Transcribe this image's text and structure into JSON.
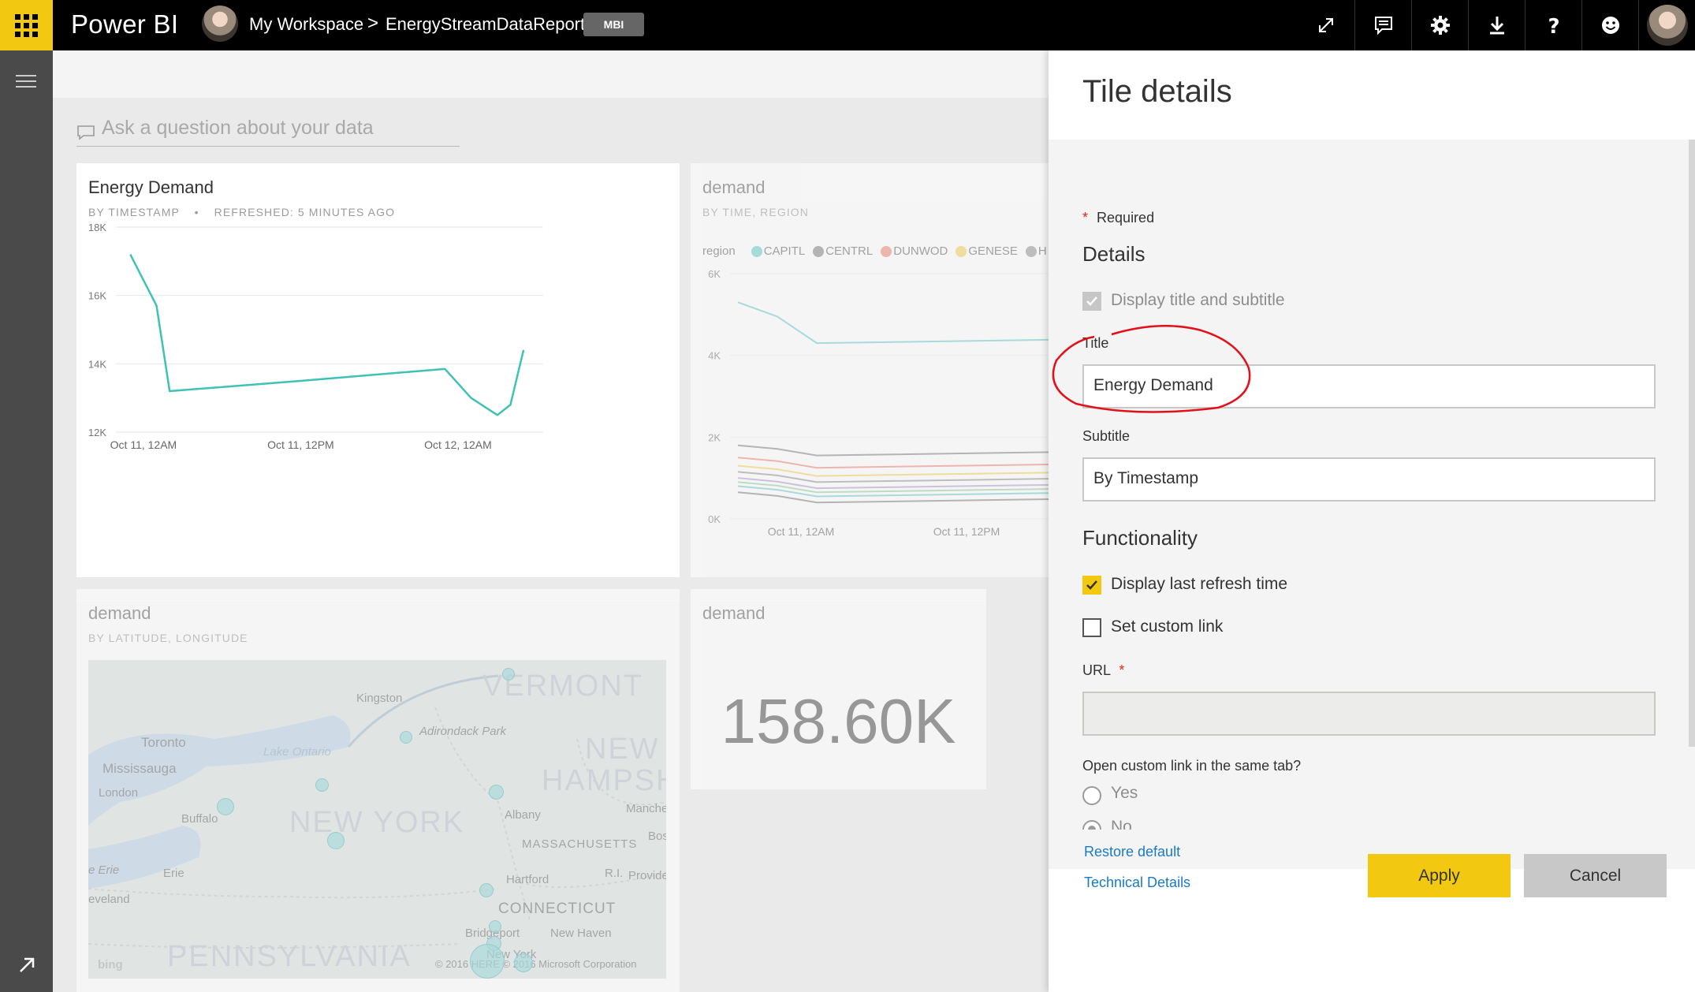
{
  "topbar": {
    "brand": "Power BI",
    "breadcrumb_workspace": "My Workspace",
    "breadcrumb_separator": ">",
    "breadcrumb_report": "EnergyStreamDataReport",
    "badge": "MBI",
    "accent_color": "#f2c811",
    "icons": [
      "expand-icon",
      "comment-icon",
      "gear-icon",
      "download-icon",
      "help-icon",
      "smiley-icon",
      "user-avatar"
    ]
  },
  "qna": {
    "placeholder": "Ask a question about your data"
  },
  "tiles": {
    "energy_demand": {
      "title": "Energy Demand",
      "subtitle": "BY TIMESTAMP",
      "separator": "•",
      "refreshed": "REFRESHED: 5 MINUTES AGO"
    },
    "demand_region": {
      "title": "demand",
      "subtitle": "BY TIME, REGION",
      "legend_label": "region",
      "legend": [
        {
          "name": "CAPITL",
          "color": "#72cdce"
        },
        {
          "name": "CENTRL",
          "color": "#888888"
        },
        {
          "name": "DUNWOD",
          "color": "#f08a7e"
        },
        {
          "name": "GENESE",
          "color": "#f2d45c"
        },
        {
          "name": "H",
          "color": "#999999"
        }
      ]
    },
    "demand_map": {
      "title": "demand",
      "subtitle": "BY LATITUDE, LONGITUDE",
      "labels": {
        "toronto": "Toronto",
        "mississauga": "Mississauga",
        "london": "London",
        "buffalo": "Buffalo",
        "kingston": "Kingston",
        "lake_ontario": "Lake Ontario",
        "adirondack": "Adirondack Park",
        "albany": "Albany",
        "erie_lake": "e Erie",
        "erie": "Erie",
        "cleveland": "eveland",
        "hartford": "Hartford",
        "providence": "Provide",
        "new_haven": "New Haven",
        "bridgeport": "Bridgeport",
        "manchester": "Manche",
        "boston": "Bos",
        "new_york_city": "New York",
        "ri": "R.I.",
        "vermont": "VERMONT",
        "new_hampshire_1": "NEW",
        "new_hampshire_2": "HAMPSHI",
        "new_york": "NEW YORK",
        "massachusetts": "MASSACHUSETTS",
        "connecticut": "CONNECTICUT",
        "pennsylvania": "PENNSYLVANIA",
        "bing": "bing",
        "copyright": "© 2016 HERE  © 2016 Microsoft Corporation"
      }
    },
    "demand_kpi": {
      "title": "demand",
      "value": "158.60K"
    }
  },
  "chart_data": [
    {
      "type": "line",
      "title": "Energy Demand",
      "subtitle": "BY TIMESTAMP",
      "x_ticks": [
        "Oct 11, 12AM",
        "Oct 11, 12PM",
        "Oct 12, 12AM"
      ],
      "y_ticks": [
        "12K",
        "14K",
        "16K",
        "18K"
      ],
      "ylim": [
        12000,
        18000
      ],
      "color": "#3fc1b7",
      "series": [
        {
          "x": [
            "Oct 10, 11PM",
            "Oct 11, 1AM",
            "Oct 11, 2AM",
            "Oct 11, 12PM",
            "Oct 11, 11PM",
            "Oct 12, 1AM",
            "Oct 12, 3AM",
            "Oct 12, 4AM",
            "Oct 12, 5AM"
          ],
          "values": [
            17200,
            15700,
            13200,
            13500,
            13850,
            13000,
            12500,
            12800,
            14400
          ]
        }
      ]
    },
    {
      "type": "line",
      "title": "demand",
      "subtitle": "BY TIME, REGION",
      "x_ticks": [
        "Oct 11, 12AM",
        "Oct 11, 12PM"
      ],
      "y_ticks": [
        "0K",
        "2K",
        "4K",
        "6K"
      ],
      "ylim": [
        0,
        6000
      ],
      "series": [
        {
          "name": "CAPITL",
          "color": "#72cdce"
        },
        {
          "name": "CENTRL",
          "color": "#888888"
        },
        {
          "name": "DUNWOD",
          "color": "#f08a7e"
        },
        {
          "name": "GENESE",
          "color": "#f2d45c"
        }
      ]
    }
  ],
  "pane": {
    "title": "Tile details",
    "required_star": "*",
    "required": "Required",
    "details_heading": "Details",
    "display_title_subtitle": "Display title and subtitle",
    "title_label": "Title",
    "title_value": "Energy Demand",
    "subtitle_label": "Subtitle",
    "subtitle_value": "By Timestamp",
    "functionality_heading": "Functionality",
    "display_refresh": "Display last refresh time",
    "custom_link": "Set custom link",
    "url_label": "URL",
    "url_value": "",
    "open_same_tab": "Open custom link in the same tab?",
    "yes": "Yes",
    "no": "No",
    "restore_default": "Restore default",
    "technical_details": "Technical Details",
    "apply": "Apply",
    "cancel": "Cancel",
    "annotation_color": "#e3101a"
  }
}
